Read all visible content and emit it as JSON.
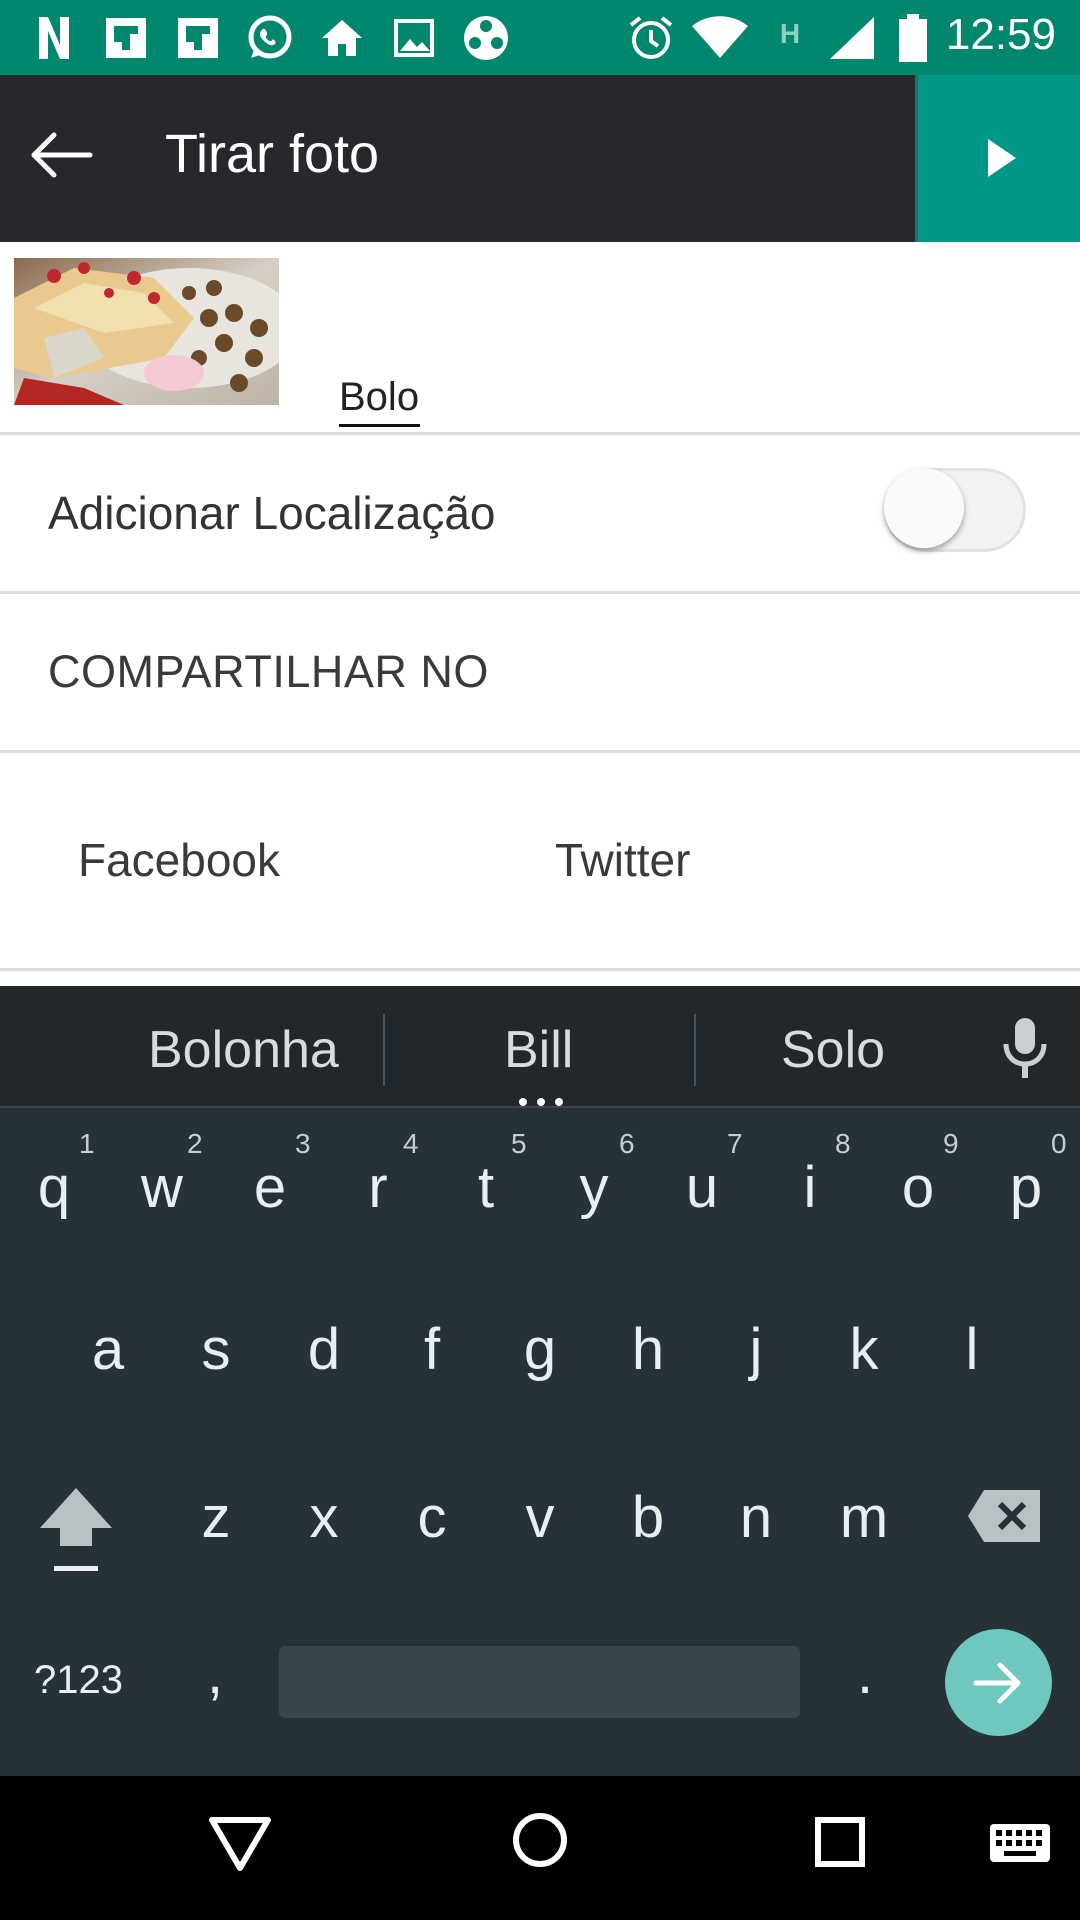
{
  "status_bar": {
    "time": "12:59",
    "network_letter": "H",
    "icons": [
      "netflix-icon",
      "flipboard-icon",
      "flipboard-icon",
      "whatsapp-icon",
      "home-icon",
      "image-icon",
      "reel-icon",
      "alarm-icon",
      "wifi-icon",
      "signal-icon",
      "battery-icon"
    ]
  },
  "app_bar": {
    "title": "Tirar foto"
  },
  "post": {
    "caption": "Bolo"
  },
  "location": {
    "label": "Adicionar Localização",
    "enabled": false
  },
  "share": {
    "header": "COMPARTILHAR NO",
    "networks": [
      "Facebook",
      "Twitter"
    ]
  },
  "keyboard": {
    "suggestions": [
      "Bolonha",
      "Bill",
      "Solo"
    ],
    "row1": [
      "q",
      "w",
      "e",
      "r",
      "t",
      "y",
      "u",
      "i",
      "o",
      "p"
    ],
    "row1_hints": [
      "1",
      "2",
      "3",
      "4",
      "5",
      "6",
      "7",
      "8",
      "9",
      "0"
    ],
    "row2": [
      "a",
      "s",
      "d",
      "f",
      "g",
      "h",
      "j",
      "k",
      "l"
    ],
    "row3": [
      "z",
      "x",
      "c",
      "v",
      "b",
      "n",
      "m"
    ],
    "symbols_label": "?123",
    "comma": ",",
    "period": "."
  },
  "colors": {
    "status_bar": "#00876d",
    "app_bar": "#26282b",
    "accent": "#009688",
    "keyboard_bg": "#263238",
    "enter_key": "#6fc8bd"
  }
}
